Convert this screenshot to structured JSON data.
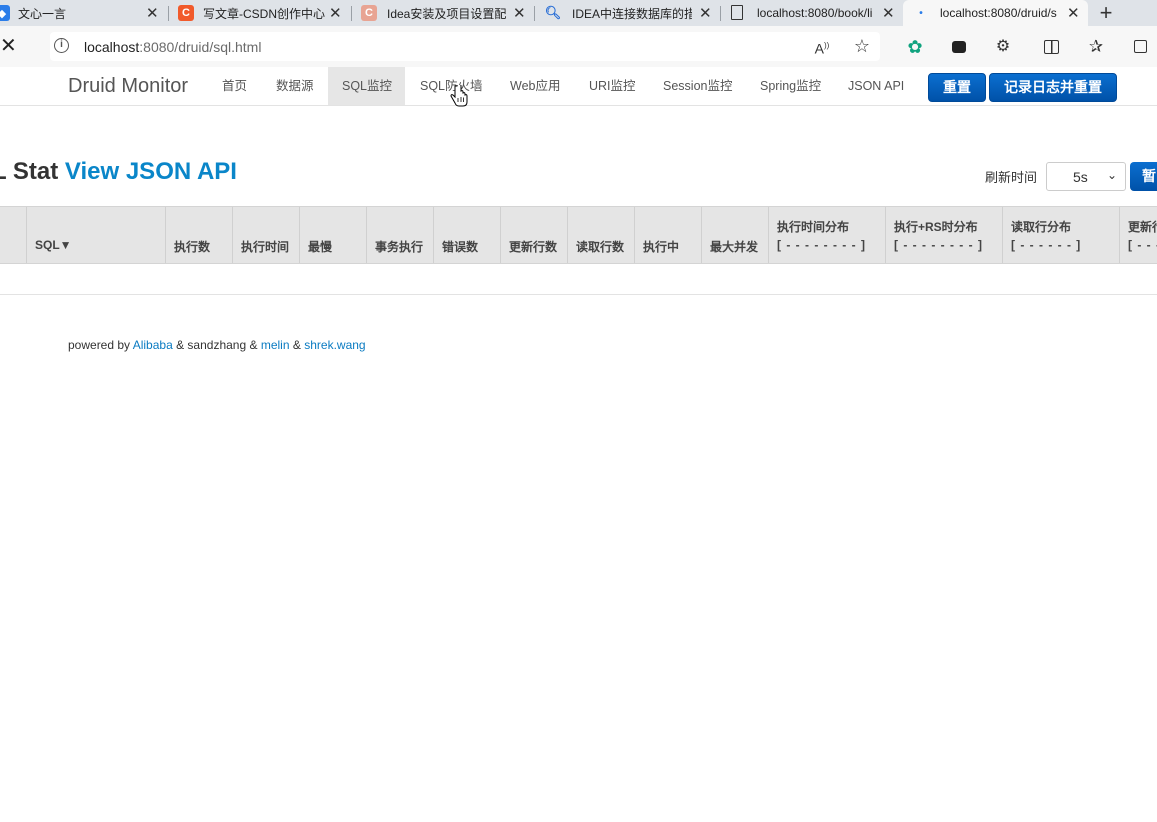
{
  "browser": {
    "tabs": [
      {
        "title": "文心一言",
        "favicon": "wenxin-icon"
      },
      {
        "title": "写文章-CSDN创作中心",
        "favicon": "csdn-icon"
      },
      {
        "title": "Idea安装及项目设置配",
        "favicon": "csdn-icon"
      },
      {
        "title": "IDEA中连接数据库的措",
        "favicon": "search-icon"
      },
      {
        "title": "localhost:8080/book/li",
        "favicon": "page-icon"
      },
      {
        "title": "localhost:8080/druid/s",
        "favicon": "loading-icon"
      }
    ],
    "url_host": "localhost",
    "url_rest": ":8080/druid/sql.html"
  },
  "druid": {
    "brand": "Druid Monitor",
    "nav": [
      "首页",
      "数据源",
      "SQL监控",
      "SQL防火墙",
      "Web应用",
      "URI监控",
      "Session监控",
      "Spring监控",
      "JSON API"
    ],
    "reset_button": "重置",
    "log_reset_button": "记录日志并重置"
  },
  "main": {
    "heading_prefix": "L Stat",
    "heading_link": "View JSON API",
    "refresh_label": "刷新时间",
    "refresh_value": "5s",
    "pause_button": "暂"
  },
  "table": {
    "columns": [
      {
        "title": "",
        "sub": ""
      },
      {
        "title": "SQL▼",
        "sub": ""
      },
      {
        "title": "执行数",
        "sub": ""
      },
      {
        "title": "执行时间",
        "sub": ""
      },
      {
        "title": "最慢",
        "sub": ""
      },
      {
        "title": "事务执行",
        "sub": ""
      },
      {
        "title": "错误数",
        "sub": ""
      },
      {
        "title": "更新行数",
        "sub": ""
      },
      {
        "title": "读取行数",
        "sub": ""
      },
      {
        "title": "执行中",
        "sub": ""
      },
      {
        "title": "最大并发",
        "sub": ""
      },
      {
        "title": "执行时间分布",
        "sub": "[ - - - - - - - - ]"
      },
      {
        "title": "执行+RS时分布",
        "sub": "[ - - - - - - - - ]"
      },
      {
        "title": "读取行分布",
        "sub": "[ - - - - - - ]"
      },
      {
        "title": "更新行",
        "sub": "[ - - -"
      }
    ]
  },
  "footer": {
    "powered_by": "powered by",
    "alibaba": "Alibaba",
    "sep1": "& sandzhang &",
    "melin": "melin",
    "sep2": "&",
    "shrek": "shrek.wang"
  }
}
